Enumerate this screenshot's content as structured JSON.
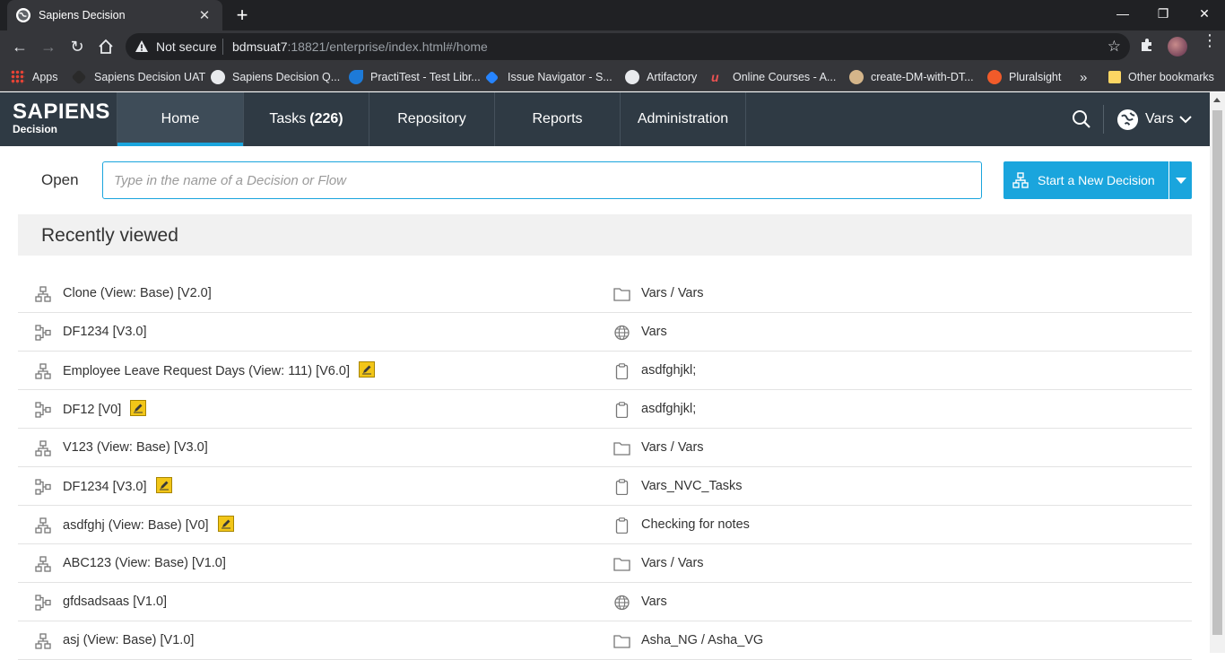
{
  "browser": {
    "tab_title": "Sapiens Decision",
    "tab_close": "✕",
    "new_tab": "+",
    "window_controls": [
      "—",
      "❐",
      "✕"
    ],
    "not_secure": "Not secure",
    "url_host": "bdmsuat7",
    "url_rest": ":18821/enterprise/index.html#/home",
    "bookmarks": [
      {
        "label": "Apps",
        "icon": "apps-grid-icon",
        "color": "#e84335"
      },
      {
        "label": "Sapiens Decision UAT",
        "icon": "sapiens-icon",
        "color": "#2a2a2a"
      },
      {
        "label": "Sapiens Decision Q...",
        "icon": "globe-icon",
        "color": "#ffffff"
      },
      {
        "label": "PractiTest - Test Libr...",
        "icon": "practitest-icon",
        "color": "#1d7ad8"
      },
      {
        "label": "Issue Navigator - S...",
        "icon": "jira-icon",
        "color": "#2684ff"
      },
      {
        "label": "Artifactory",
        "icon": "globe-icon",
        "color": "#ffffff"
      },
      {
        "label": "Online Courses - A...",
        "icon": "udemy-icon",
        "color": "#ec5252"
      },
      {
        "label": "create-DM-with-DT...",
        "icon": "jenkins-icon",
        "color": "#d4b58a"
      },
      {
        "label": "Pluralsight",
        "icon": "pluralsight-icon",
        "color": "#f15b2a"
      }
    ],
    "more_bookmarks": "»",
    "other_bookmarks": "Other bookmarks"
  },
  "app": {
    "logo_main": "SAPIENS",
    "logo_sub": "Decision",
    "nav": [
      {
        "label": "Home",
        "count": ""
      },
      {
        "label": "Tasks",
        "count": "(226)"
      },
      {
        "label": "Repository",
        "count": ""
      },
      {
        "label": "Reports",
        "count": ""
      },
      {
        "label": "Administration",
        "count": ""
      }
    ],
    "user": "Vars",
    "accent": "#1aa5dd"
  },
  "open": {
    "label": "Open",
    "placeholder": "Type in the name of a Decision or Flow",
    "start_button": "Start a New Decision"
  },
  "recent": {
    "title": "Recently viewed",
    "items": [
      {
        "name": "Clone (View: Base) [V2.0]",
        "type": "decision",
        "note": false,
        "location": "Vars / Vars",
        "loc_type": "folder"
      },
      {
        "name": "DF1234 [V3.0]",
        "type": "flow",
        "note": false,
        "location": "Vars",
        "loc_type": "globe"
      },
      {
        "name": "Employee Leave Request Days (View: 111) [V6.0]",
        "type": "decision",
        "note": true,
        "location": "asdfghjkl;",
        "loc_type": "clipboard"
      },
      {
        "name": "DF12 [V0]",
        "type": "flow",
        "note": true,
        "location": "asdfghjkl;",
        "loc_type": "clipboard"
      },
      {
        "name": "V123 (View: Base) [V3.0]",
        "type": "decision",
        "note": false,
        "location": "Vars / Vars",
        "loc_type": "folder"
      },
      {
        "name": "DF1234 [V3.0]",
        "type": "flow",
        "note": true,
        "location": "Vars_NVC_Tasks",
        "loc_type": "clipboard"
      },
      {
        "name": "asdfghj (View: Base) [V0]",
        "type": "decision",
        "note": true,
        "location": "Checking for notes",
        "loc_type": "clipboard"
      },
      {
        "name": "ABC123 (View: Base) [V1.0]",
        "type": "decision",
        "note": false,
        "location": "Vars / Vars",
        "loc_type": "folder"
      },
      {
        "name": "gfdsadsaas [V1.0]",
        "type": "flow",
        "note": false,
        "location": "Vars",
        "loc_type": "globe"
      },
      {
        "name": "asj (View: Base) [V1.0]",
        "type": "decision",
        "note": false,
        "location": "Asha_NG / Asha_VG",
        "loc_type": "folder"
      }
    ]
  }
}
